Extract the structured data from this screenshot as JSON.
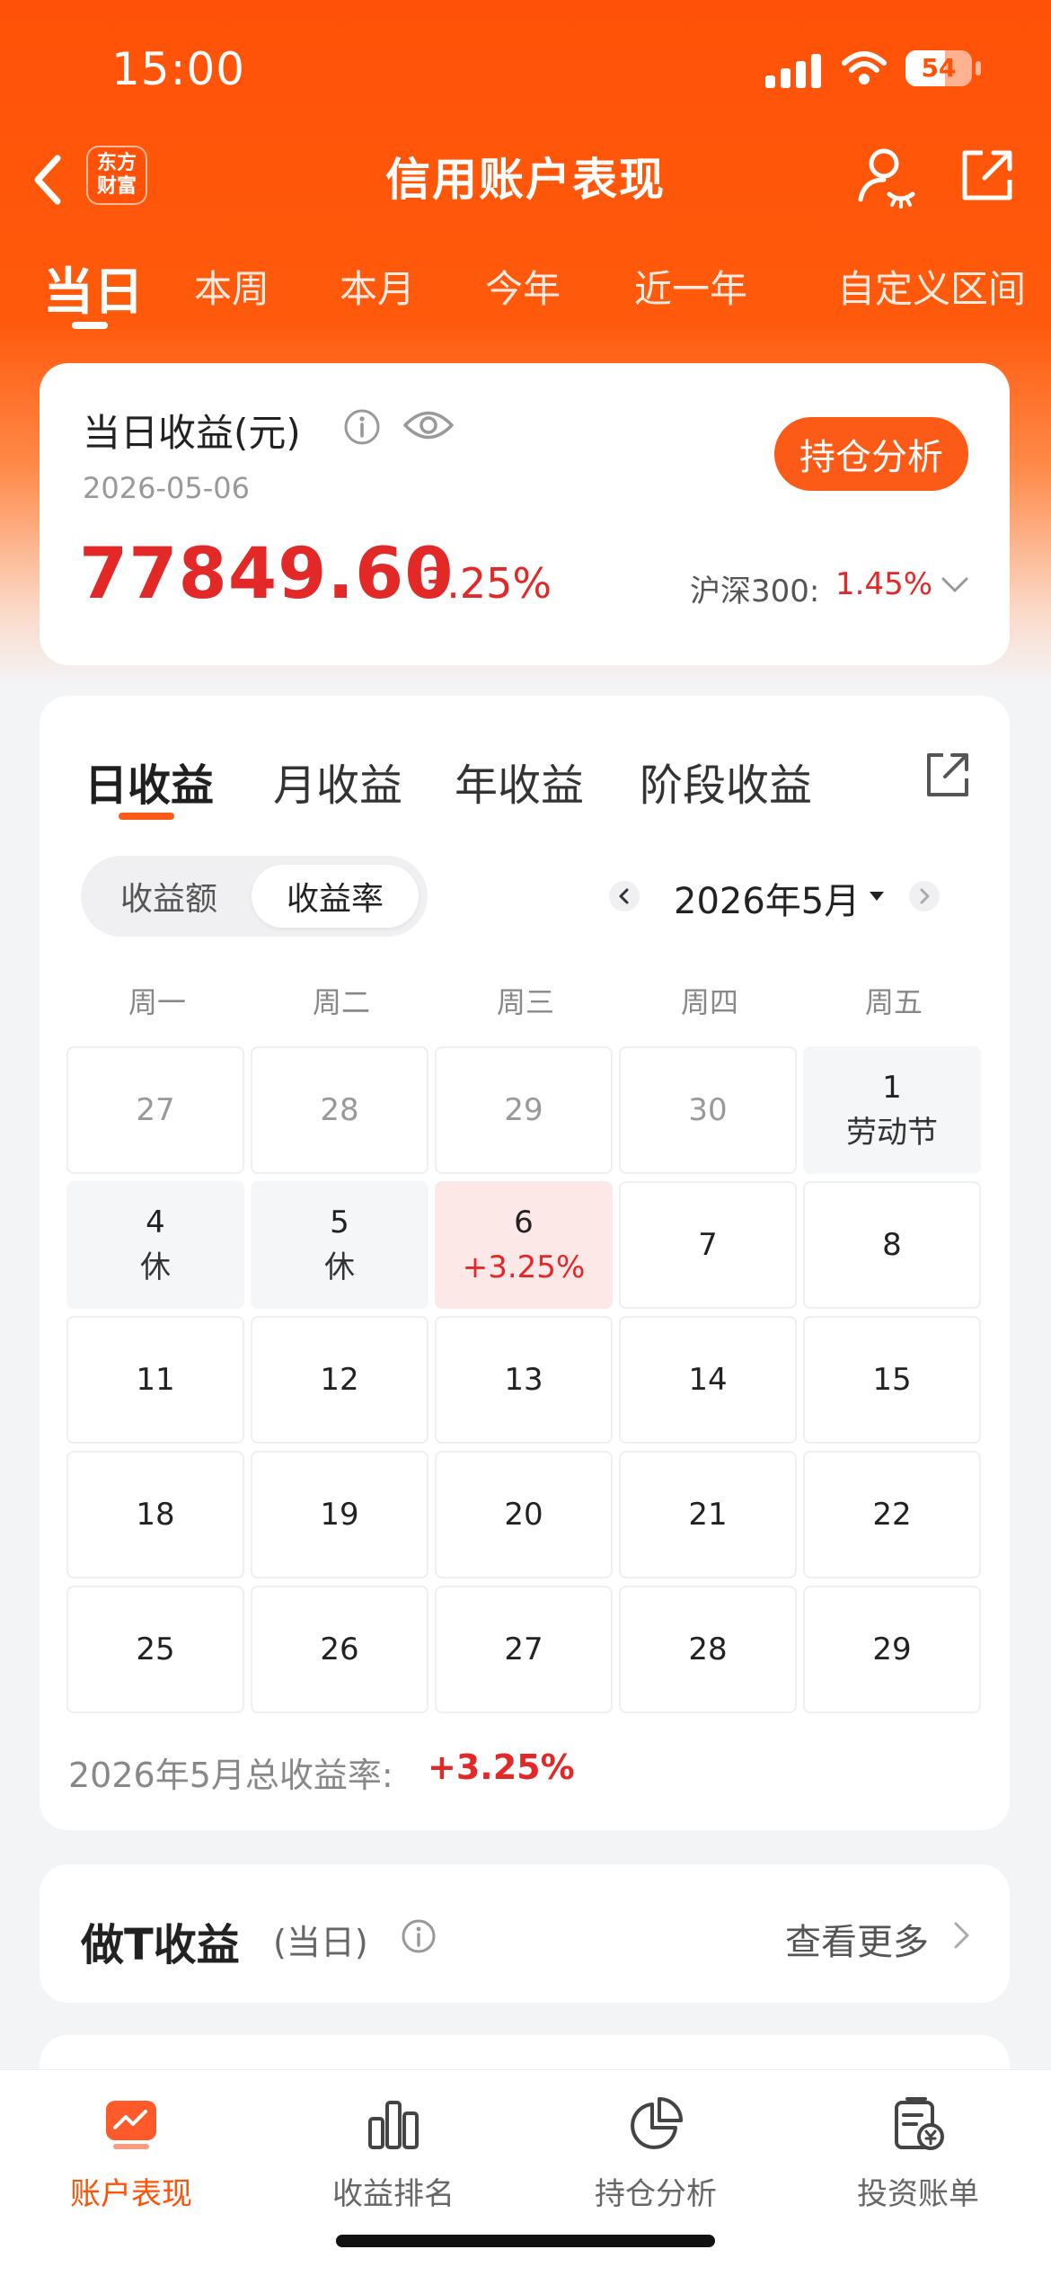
{
  "status_bar": {
    "time": "15:00",
    "battery": "54"
  },
  "nav": {
    "logo_line1": "东方",
    "logo_line2": "财富",
    "title": "信用账户表现"
  },
  "period_tabs": [
    {
      "label": "当日",
      "active": true
    },
    {
      "label": "本周"
    },
    {
      "label": "本月"
    },
    {
      "label": "今年"
    },
    {
      "label": "近一年"
    },
    {
      "label": "自定义区间"
    }
  ],
  "summary": {
    "title": "当日收益(元)",
    "date": "2026-05-06",
    "value": "77849.60",
    "rate": "3.25%",
    "button": "持仓分析",
    "benchmark_label": "沪深300:",
    "benchmark_value": "1.45%"
  },
  "calendar": {
    "tabs": [
      "日收益",
      "月收益",
      "年收益",
      "阶段收益"
    ],
    "segment": [
      "收益额",
      "收益率"
    ],
    "month": "2026年5月",
    "weekdays": [
      "周一",
      "周二",
      "周三",
      "周四",
      "周五"
    ],
    "rows": [
      [
        {
          "day": "27"
        },
        {
          "day": "28"
        },
        {
          "day": "29"
        },
        {
          "day": "30"
        },
        {
          "day": "1",
          "sub": "劳动节"
        }
      ],
      [
        {
          "day": "4",
          "sub": "休"
        },
        {
          "day": "5",
          "sub": "休"
        },
        {
          "day": "6",
          "sub": "+3.25%"
        },
        {
          "day": "7"
        },
        {
          "day": "8"
        }
      ],
      [
        {
          "day": "11"
        },
        {
          "day": "12"
        },
        {
          "day": "13"
        },
        {
          "day": "14"
        },
        {
          "day": "15"
        }
      ],
      [
        {
          "day": "18"
        },
        {
          "day": "19"
        },
        {
          "day": "20"
        },
        {
          "day": "21"
        },
        {
          "day": "22"
        }
      ],
      [
        {
          "day": "25"
        },
        {
          "day": "26"
        },
        {
          "day": "27"
        },
        {
          "day": "28"
        },
        {
          "day": "29"
        }
      ]
    ],
    "total_label": "2026年5月总收益率:",
    "total_value": "+3.25%"
  },
  "t_card": {
    "title": "做T收益",
    "sub": "(当日)",
    "more": "查看更多"
  },
  "bottom_nav": [
    {
      "label": "账户表现",
      "icon": "trend-chart-icon",
      "active": true
    },
    {
      "label": "收益排名",
      "icon": "bar-chart-icon"
    },
    {
      "label": "持仓分析",
      "icon": "pie-chart-icon"
    },
    {
      "label": "投资账单",
      "icon": "bill-icon"
    }
  ],
  "colors": {
    "brand": "#ff5208",
    "gain": "#e32828"
  }
}
